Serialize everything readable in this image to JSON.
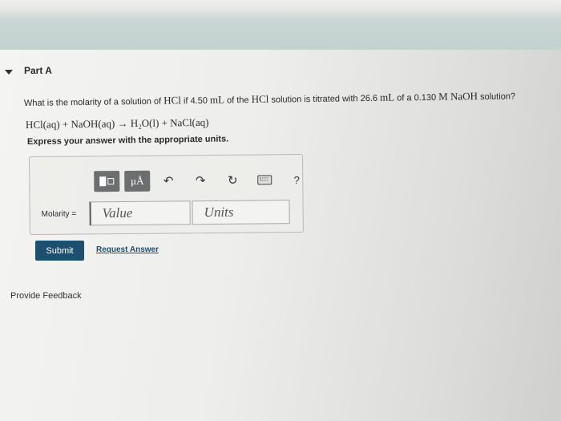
{
  "part": {
    "title": "Part A"
  },
  "question": {
    "prefix": "What is the molarity of a solution of ",
    "acid": "HCl",
    "mid1": " if 4.50 ",
    "unit1": "mL",
    "mid2": " of the ",
    "acid2": "HCl",
    "mid3": " solution is titrated with 26.6 ",
    "unit2": "mL",
    "mid4": " of a 0.130 ",
    "base": "M NaOH",
    "suffix": " solution?"
  },
  "equation": "HCl(aq) + NaOH(aq) → H₂O(l) + NaCl(aq)",
  "instruction": "Express your answer with the appropriate units.",
  "toolbar": {
    "mu_label": "μÅ",
    "undo_symbol": "↶",
    "redo_symbol": "↷",
    "reset_symbol": "↻",
    "help_label": "?"
  },
  "answer": {
    "label": "Molarity =",
    "value_placeholder": "Value",
    "units_placeholder": "Units"
  },
  "buttons": {
    "submit": "Submit",
    "request_answer": "Request Answer",
    "provide_feedback": "Provide Feedback"
  }
}
